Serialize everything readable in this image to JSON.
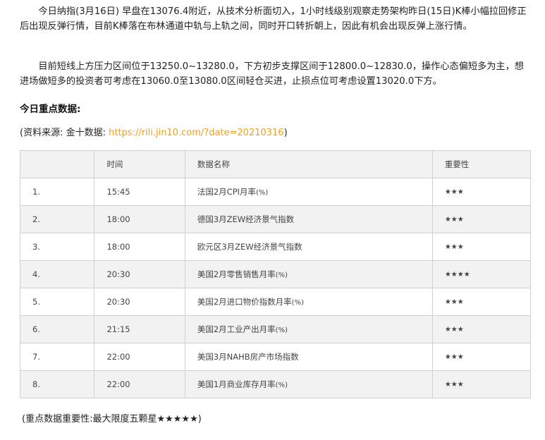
{
  "article": {
    "para1": "今日纳指(3月16日) 早盘在13076.4附近，从技术分析面切入，1小时线级别观察走势架构昨日(15日)K棒小幅拉回修正后出现反弹行情，目前K棒落在布林通道中轨与上轨之间，同时开口转折朝上，因此有机会出现反弹上涨行情。",
    "para2": "目前短线上方压力区间位于13250.0~13280.0，下方初步支撑区间于12800.0~12830.0，操作心态偏短多为主，想进场做短多的投资者可考虑在13060.0至13080.0区间轻仓买进，止损点位可考虑设置13020.0下方。",
    "heading": "今日重点数据:",
    "source_prefix": "(资料来源: 金十数据: ",
    "source_link": "https://rili.jin10.com/?date=20210316",
    "source_suffix": ")",
    "note": "(重点数据重要性:最大限度五颗星★★★★★)"
  },
  "table": {
    "headers": [
      "",
      "时间",
      "数据名称",
      "重要性"
    ],
    "rows": [
      {
        "no": "1.",
        "time": "15:45",
        "name": "法国2月CPI月率",
        "unit": "(%)",
        "stars": "★★★"
      },
      {
        "no": "2.",
        "time": "18:00",
        "name": "德国3月ZEW经济景气指数",
        "unit": "",
        "stars": "★★★"
      },
      {
        "no": "3.",
        "time": "18:00",
        "name": "欧元区3月ZEW经济景气指数",
        "unit": "",
        "stars": "★★★"
      },
      {
        "no": "4.",
        "time": "20:30",
        "name": "美国2月零售销售月率",
        "unit": "(%)",
        "stars": "★★★★"
      },
      {
        "no": "5.",
        "time": "20:30",
        "name": "美国2月进口物价指数月率",
        "unit": "(%)",
        "stars": "★★★"
      },
      {
        "no": "6.",
        "time": "21:15",
        "name": "美国2月工业产出月率",
        "unit": "(%)",
        "stars": "★★★"
      },
      {
        "no": "7.",
        "time": "22:00",
        "name": "美国3月NAHB房产市场指数",
        "unit": "",
        "stars": "★★★"
      },
      {
        "no": "8.",
        "time": "22:00",
        "name": "美国1月商业库存月率",
        "unit": "(%)",
        "stars": "★★★"
      }
    ]
  }
}
